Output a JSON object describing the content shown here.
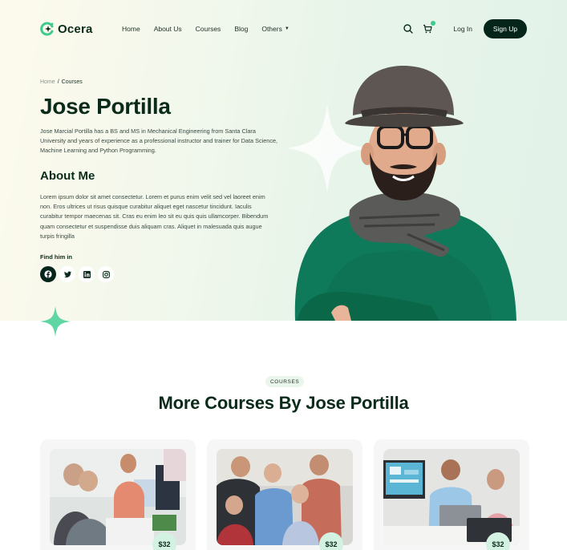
{
  "brand": {
    "name": "Ocera",
    "accent": "#3ecb8e",
    "dark": "#06251a"
  },
  "nav": {
    "items": [
      {
        "label": "Home"
      },
      {
        "label": "About Us"
      },
      {
        "label": "Courses"
      },
      {
        "label": "Blog"
      },
      {
        "label": "Others",
        "has_dropdown": true
      }
    ],
    "icons": [
      "search-icon",
      "cart-icon"
    ],
    "login_label": "Log In",
    "signup_label": "Sign Up"
  },
  "breadcrumb": {
    "home": "Home",
    "separator": "/",
    "current": "Courses"
  },
  "instructor": {
    "name": "Jose Portilla",
    "bio": "Jose Marcial Portilla has a BS and MS in Mechanical Engineering from Santa Clara University and years of experience as a professional instructor and trainer for Data Science, Machine Learning and Python Programming.",
    "about_heading": "About Me",
    "about_text": "Lorem ipsum dolor sit amet consectetur. Lorem et purus enim velit sed vel laoreet enim non. Eros ultrices ut risus quisque curabitur aliquet eget nascetur tincidunt. Iaculis curabitur tempor maecenas sit. Cras eu enim leo sit eu quis quis ullamcorper. Bibendum quam consectetur et suspendisse duis aliquam cras. Aliquet in malesuada quis augue turpis fringilla",
    "find_label": "Find him in",
    "socials": [
      "facebook-icon",
      "twitter-icon",
      "linkedin-icon",
      "instagram-icon"
    ]
  },
  "courses_section": {
    "badge": "COURSES",
    "title": "More Courses By Jose Portilla",
    "cards": [
      {
        "price": "$32",
        "image": "team-meeting-photo"
      },
      {
        "price": "$32",
        "image": "group-collaboration-photo"
      },
      {
        "price": "$32",
        "image": "office-laptop-photo"
      }
    ]
  }
}
